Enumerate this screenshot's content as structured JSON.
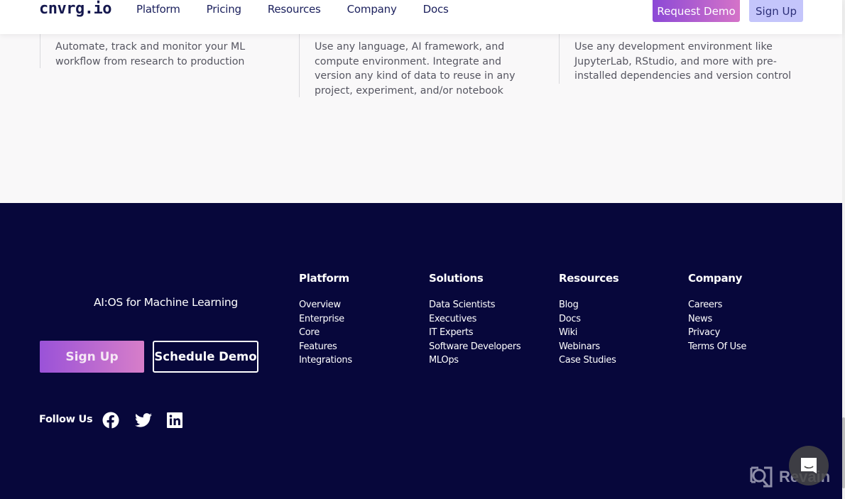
{
  "header": {
    "logo": "cnvrg.io",
    "nav": [
      "Platform",
      "Pricing",
      "Resources",
      "Company",
      "Docs"
    ],
    "request_demo_label": "Request Demo",
    "sign_up_label": "Sign Up"
  },
  "features": [
    {
      "text": "Automate, track and monitor your ML\nworkflow from research to production"
    },
    {
      "text": "Use any language, AI framework, and\ncompute environment. Integrate and\nversion any kind of data to reuse in any\nproject, experiment, and/or notebook"
    },
    {
      "text": "Use any development environment like\nJupyterLab, RStudio, and more with pre-\ninstalled dependencies and version control"
    }
  ],
  "footer": {
    "tagline": "AI:OS for Machine Learning",
    "sign_up_label": "Sign Up",
    "schedule_demo_label": "Schedule Demo",
    "follow_us_label": "Follow Us",
    "social_icons": [
      "facebook-icon",
      "twitter-icon",
      "linkedin-icon"
    ],
    "columns": [
      {
        "title": "Platform",
        "links": [
          "Overview",
          "Enterprise",
          "Core",
          "Features",
          "Integrations"
        ]
      },
      {
        "title": "Solutions",
        "links": [
          "Data Scientists",
          "Executives",
          "IT Experts",
          "Software Developers",
          "MLOps"
        ]
      },
      {
        "title": "Resources",
        "links": [
          "Blog",
          "Docs",
          "Wiki",
          "Webinars",
          "Case Studies"
        ]
      },
      {
        "title": "Company",
        "links": [
          "Careers",
          "News",
          "Privacy",
          "Terms Of Use"
        ]
      }
    ]
  },
  "watermark": {
    "label": "Revain"
  },
  "colors": {
    "footer_bg": "#07073b",
    "accent_gradient_start": "#8c49d6",
    "accent_gradient_end": "#d573c8",
    "signup_top_bg": "#c4c5fb",
    "nav_text": "#1a1f5c"
  }
}
